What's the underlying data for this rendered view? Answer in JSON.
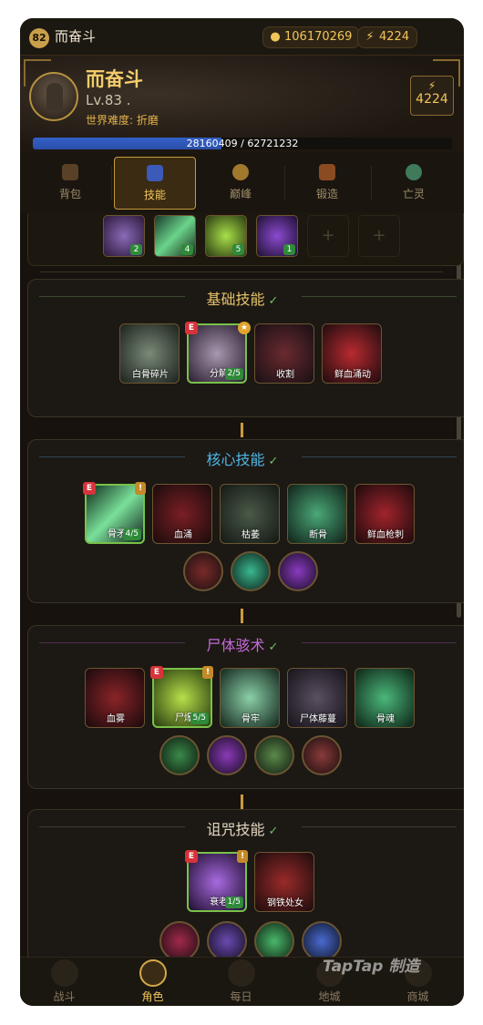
{
  "topbar": {
    "level": "82",
    "name": "而奋斗",
    "gold": "106170269",
    "gold_icon": "money-bag-icon",
    "energy": "4224",
    "energy_icon": "lightning-icon"
  },
  "hero": {
    "name": "而奋斗",
    "level": "Lv.83 .",
    "difficulty": "世界难度: 折磨",
    "energy_value": "4224",
    "xp_text": "28160409 / 62721232",
    "xp_progress": 0.449
  },
  "tabs": [
    {
      "label": "背包",
      "icon": "backpack-icon"
    },
    {
      "label": "技能",
      "icon": "skill-book-icon"
    },
    {
      "label": "巅峰",
      "icon": "paragon-board-icon"
    },
    {
      "label": "锻造",
      "icon": "anvil-icon"
    },
    {
      "label": "亡灵",
      "icon": "undead-skull-icon"
    }
  ],
  "equipped": [
    {
      "count": "2",
      "icon": "skull-skill-icon"
    },
    {
      "count": "4",
      "icon": "bone-spear-icon"
    },
    {
      "count": "5",
      "icon": "corpse-explosion-icon"
    },
    {
      "count": "1",
      "icon": "decrepify-icon"
    },
    {
      "count": "",
      "icon": "plus-icon"
    },
    {
      "count": "",
      "icon": "plus-icon"
    }
  ],
  "sections": {
    "basic": {
      "title": "基础技能",
      "check": "✓",
      "skills": [
        {
          "label": "白骨碎片"
        },
        {
          "label": "分解",
          "count": "2/5",
          "badge": "E"
        },
        {
          "label": "收割"
        },
        {
          "label": "鲜血涌动"
        }
      ]
    },
    "core": {
      "title": "核心技能",
      "check": "✓",
      "skills": [
        {
          "label": "骨矛",
          "count": "4/5",
          "badge": "E"
        },
        {
          "label": "血涌"
        },
        {
          "label": "枯萎"
        },
        {
          "label": "断骨"
        },
        {
          "label": "鲜血枪刺"
        }
      ]
    },
    "corpse": {
      "title": "尸体骇术",
      "check": "✓",
      "skills": [
        {
          "label": "血雾"
        },
        {
          "label": "尸爆",
          "count": "5/5",
          "badge": "E"
        },
        {
          "label": "骨牢"
        },
        {
          "label": "尸体藤蔓"
        },
        {
          "label": "骨魂"
        }
      ]
    },
    "curse": {
      "title": "诅咒技能",
      "check": "✓",
      "skills": [
        {
          "label": "衰老",
          "count": "1/5",
          "badge": "E"
        },
        {
          "label": "钢铁处女"
        }
      ]
    }
  },
  "bottomnav": [
    {
      "label": "战斗",
      "icon": "battle-icon"
    },
    {
      "label": "角色",
      "icon": "character-icon"
    },
    {
      "label": "每日",
      "icon": "daily-chest-icon"
    },
    {
      "label": "地城",
      "icon": "dungeon-icon"
    },
    {
      "label": "商城",
      "icon": "shop-icon"
    }
  ],
  "watermark": "TapTap 制造",
  "colors": {
    "accent_gold": "#f3c75e",
    "xp_blue": "#3460c8",
    "count_green": "#2f8a3a",
    "section_core_title": "#4fb6e6",
    "section_corpse_title": "#c46ad8"
  }
}
